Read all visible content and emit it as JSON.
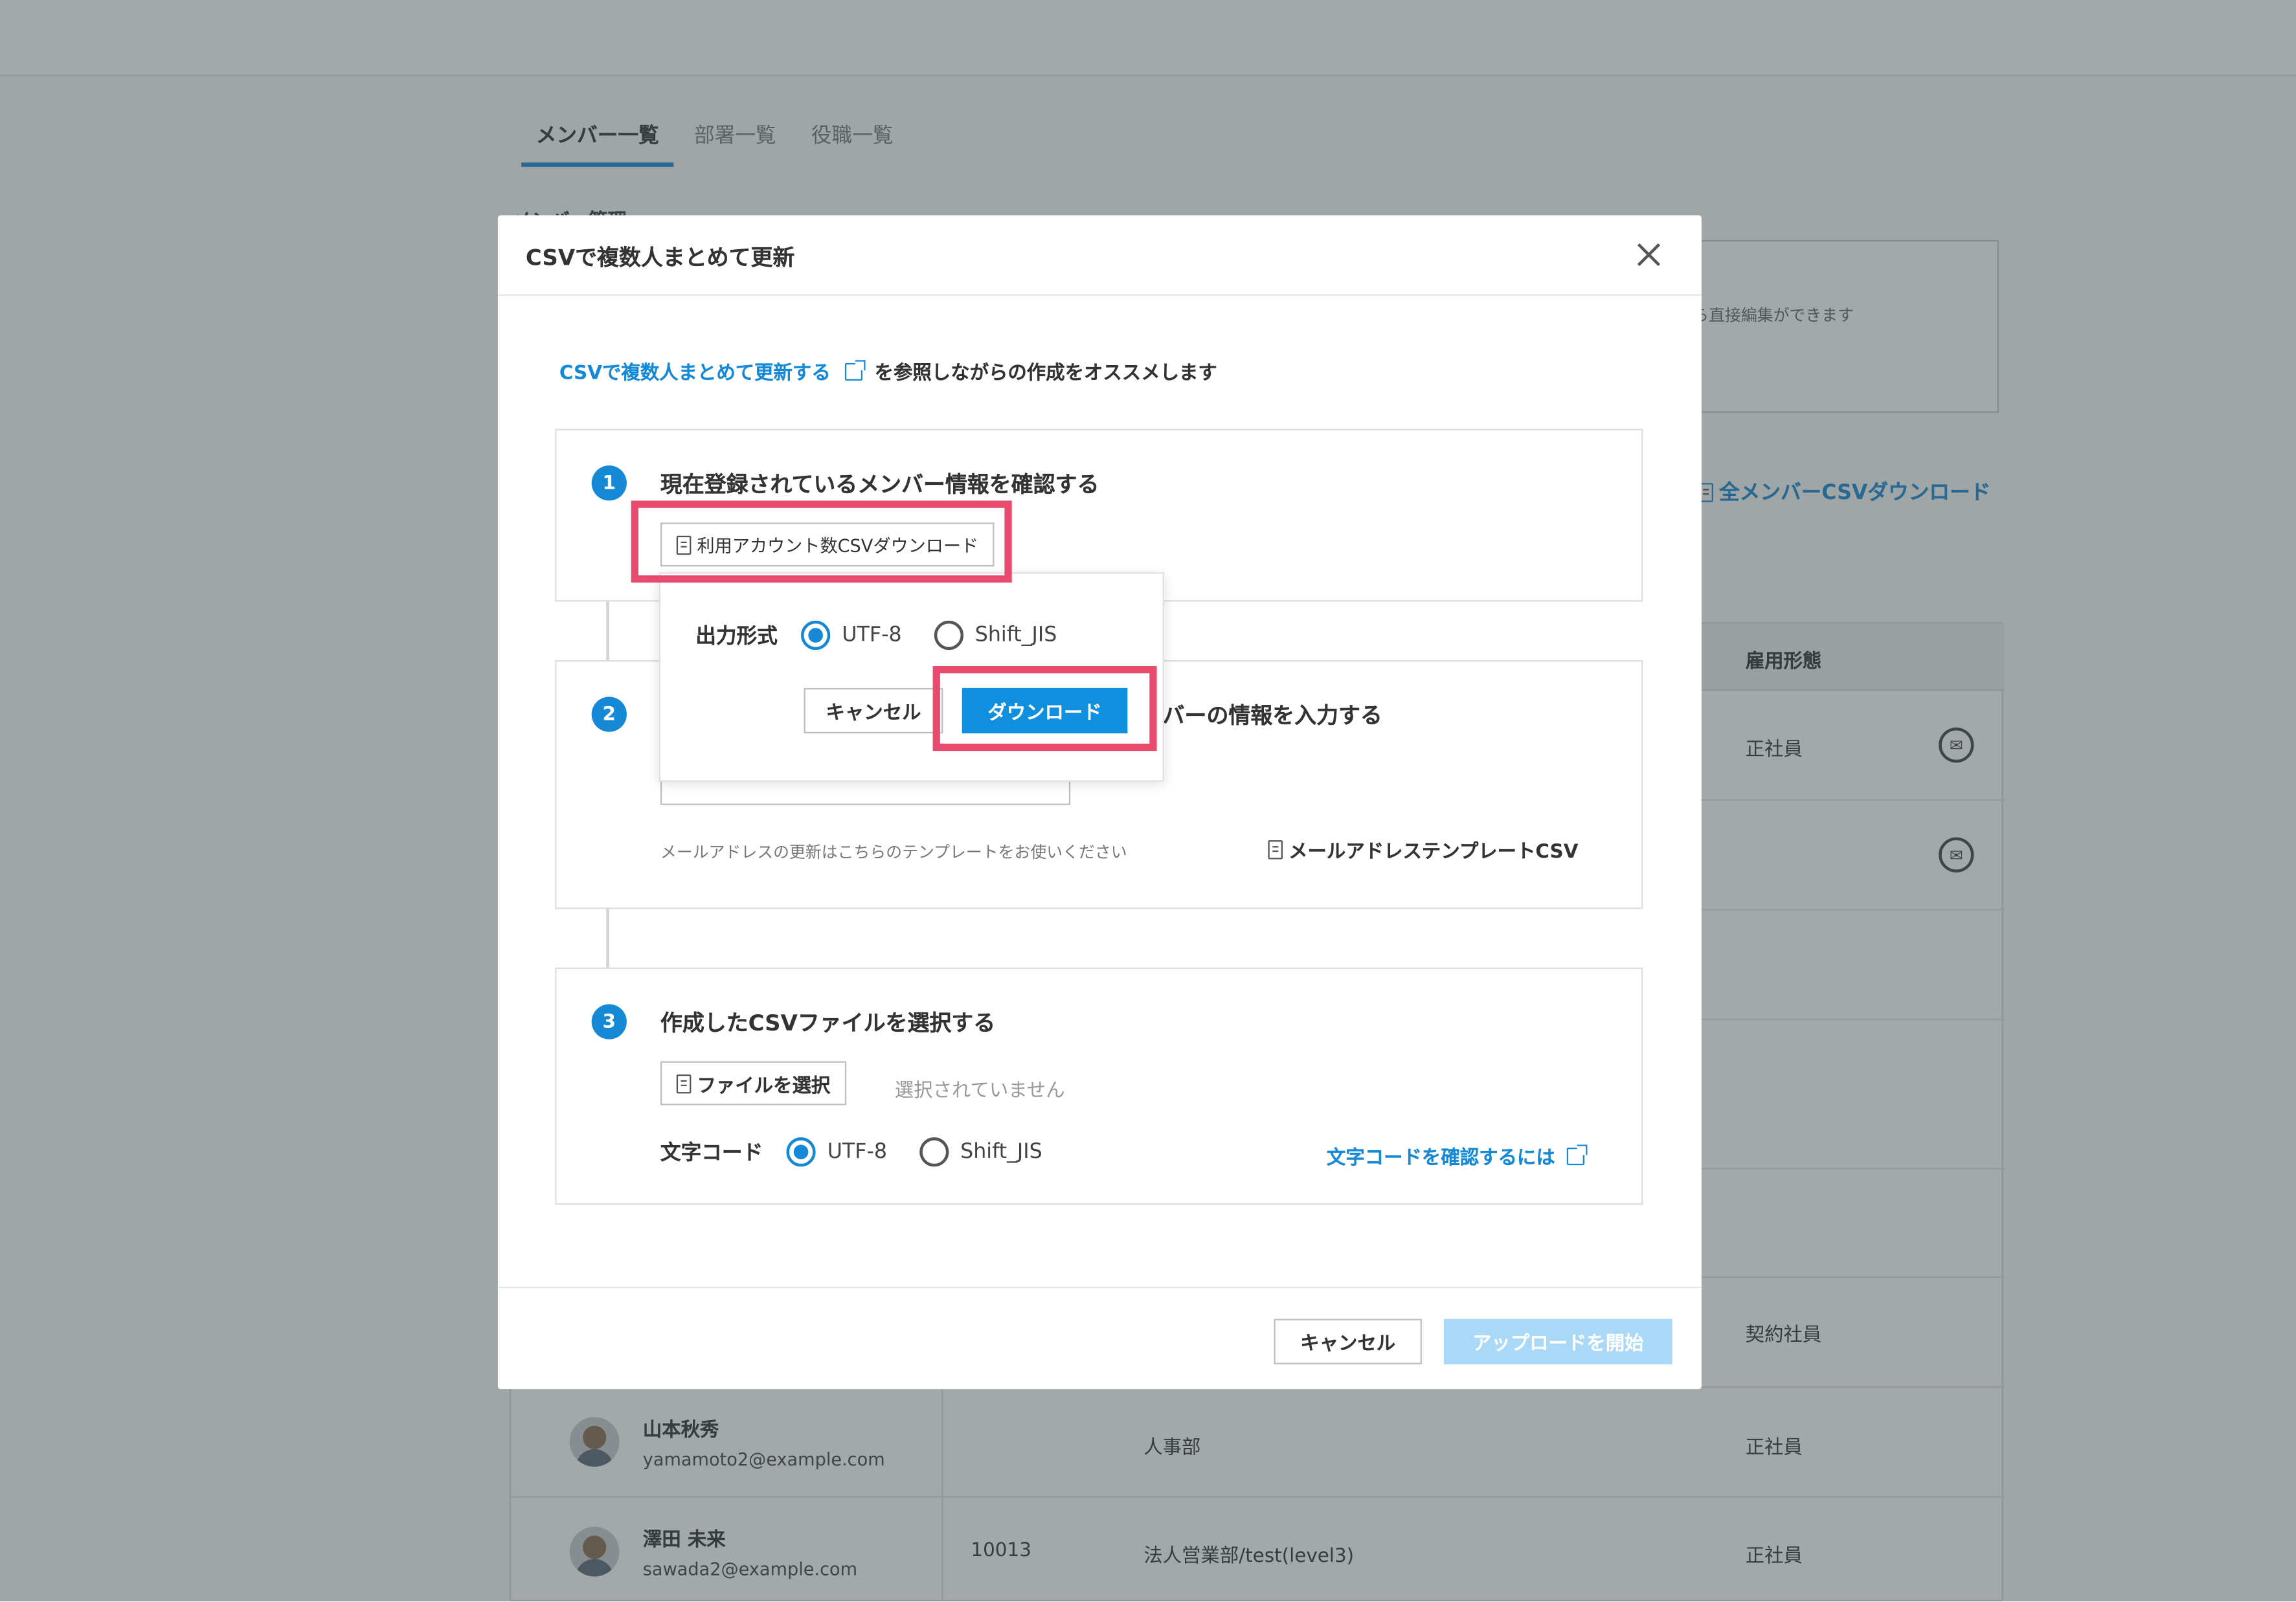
{
  "tabs": [
    {
      "label": "メンバー一覧",
      "active": true
    },
    {
      "label": "部署一覧",
      "active": false
    },
    {
      "label": "役職一覧",
      "active": false
    }
  ],
  "background": {
    "section_heading": "メンバー管理",
    "info_text": "ら直接編集ができます",
    "all_csv_link": "全メンバーCSVダウンロード",
    "table": {
      "header_employment": "雇用形態",
      "rows": [
        {
          "employment": "正社員"
        },
        {
          "employment": ""
        },
        {
          "employment": "契約社員"
        },
        {
          "name": "山本秋秀",
          "email": "yamamoto2@example.com",
          "code": "",
          "dept": "人事部",
          "employment": "正社員"
        },
        {
          "name": "澤田 未来",
          "email": "sawada2@example.com",
          "code": "10013",
          "dept": "法人営業部/test(level3)",
          "employment": "正社員"
        }
      ]
    }
  },
  "modal": {
    "title": "CSVで複数人まとめて更新",
    "intro_link": "CSVで複数人まとめて更新する",
    "intro_text": "を参照しながらの作成をオススメします",
    "step1": {
      "number": "1",
      "title": "現在登録されているメンバー情報を確認する",
      "button": "利用アカウント数CSVダウンロード"
    },
    "step2": {
      "number": "2",
      "title_visible": "バーの情報を入力する",
      "hint": "メールアドレスの更新はこちらのテンプレートをお使いください",
      "email_template_link": "メールアドレステンプレートCSV"
    },
    "step3": {
      "number": "3",
      "title": "作成したCSVファイルを選択する",
      "file_button": "ファイルを選択",
      "file_status": "選択されていません",
      "encoding_label": "文字コード",
      "options": [
        "UTF-8",
        "Shift_JIS"
      ],
      "selected": "UTF-8",
      "check_link": "文字コードを確認するには"
    },
    "footer": {
      "cancel": "キャンセル",
      "upload": "アップロードを開始"
    }
  },
  "popover": {
    "format_label": "出力形式",
    "options": [
      "UTF-8",
      "Shift_JIS"
    ],
    "selected": "UTF-8",
    "cancel": "キャンセル",
    "download": "ダウンロード"
  },
  "colors": {
    "accent": "#1589d6",
    "highlight": "#e84b6e",
    "upload_disabled": "#a9d9f6"
  }
}
